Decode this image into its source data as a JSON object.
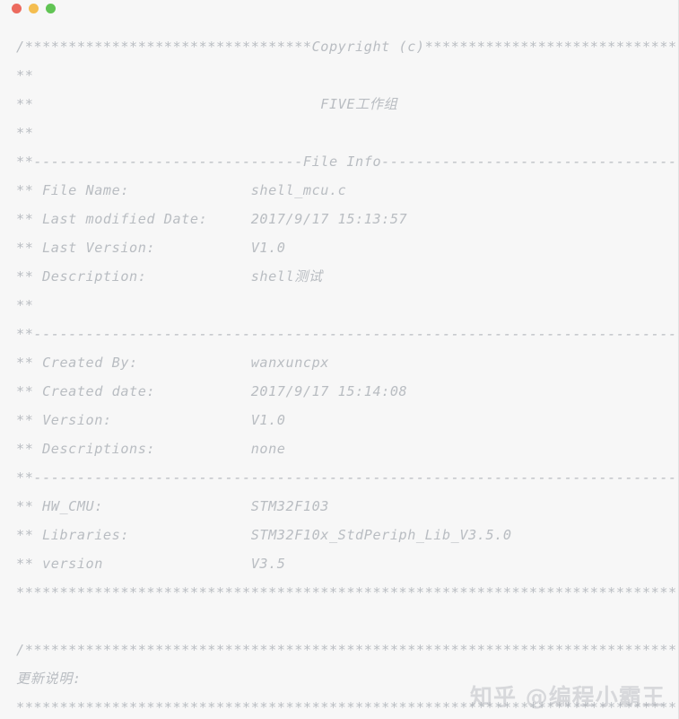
{
  "window": {
    "background_color": "#f7f7f7",
    "text_color": "#b9bdc2"
  },
  "title_bar": {
    "traffic_lights": [
      {
        "name": "close",
        "label": "Close",
        "color": "#ec6a5e"
      },
      {
        "name": "minimize",
        "label": "Minimize",
        "color": "#f4bd4f"
      },
      {
        "name": "maximize",
        "label": "Maximize",
        "color": "#61c454"
      }
    ]
  },
  "code": {
    "language": "c",
    "file_name": "shell_mcu.c",
    "lines": [
      "/*********************************Copyright (c)***********************************",
      "**",
      "**                                 FIVE工作组",
      "**",
      "**-------------------------------File Info----------------------------------------",
      "** File Name:              shell_mcu.c",
      "** Last modified Date:     2017/9/17 15:13:57",
      "** Last Version:           V1.0",
      "** Description:            shell测试",
      "**",
      "**--------------------------------------------------------------------------------",
      "** Created By:             wanxuncpx",
      "** Created date:           2017/9/17 15:14:08",
      "** Version:                V1.0",
      "** Descriptions:           none",
      "**--------------------------------------------------------------------------------",
      "** HW_CMU:                 STM32F103",
      "** Libraries:              STM32F10x_StdPeriph_Lib_V3.5.0",
      "** version                 V3.5",
      "**********************************************************************************",
      "",
      "/*********************************************************************************",
      "更新说明:",
      "**********************************************************************************"
    ],
    "fields": [
      {
        "label": "** File Name:",
        "value": "shell_mcu.c"
      },
      {
        "label": "** Last modified Date:",
        "value": "2017/9/17 15:13:57"
      },
      {
        "label": "** Last Version:",
        "value": "V1.0"
      },
      {
        "label": "** Description:",
        "value": "shell测试"
      },
      {
        "label": "** Created By:",
        "value": "wanxuncpx"
      },
      {
        "label": "** Created date:",
        "value": "2017/9/17 15:14:08"
      },
      {
        "label": "** Version:",
        "value": "V1.0"
      },
      {
        "label": "** Descriptions:",
        "value": "none"
      },
      {
        "label": "** HW_CMU:",
        "value": "STM32F103"
      },
      {
        "label": "** Libraries:",
        "value": "STM32F10x_StdPeriph_Lib_V3.5.0"
      },
      {
        "label": "** version",
        "value": "V3.5"
      }
    ],
    "section_headers": [
      "Copyright (c)",
      "File Info"
    ],
    "org_name": "FIVE工作组",
    "update_notes_label": "更新说明:"
  },
  "watermark": {
    "text": "知乎 @编程小霸王"
  }
}
